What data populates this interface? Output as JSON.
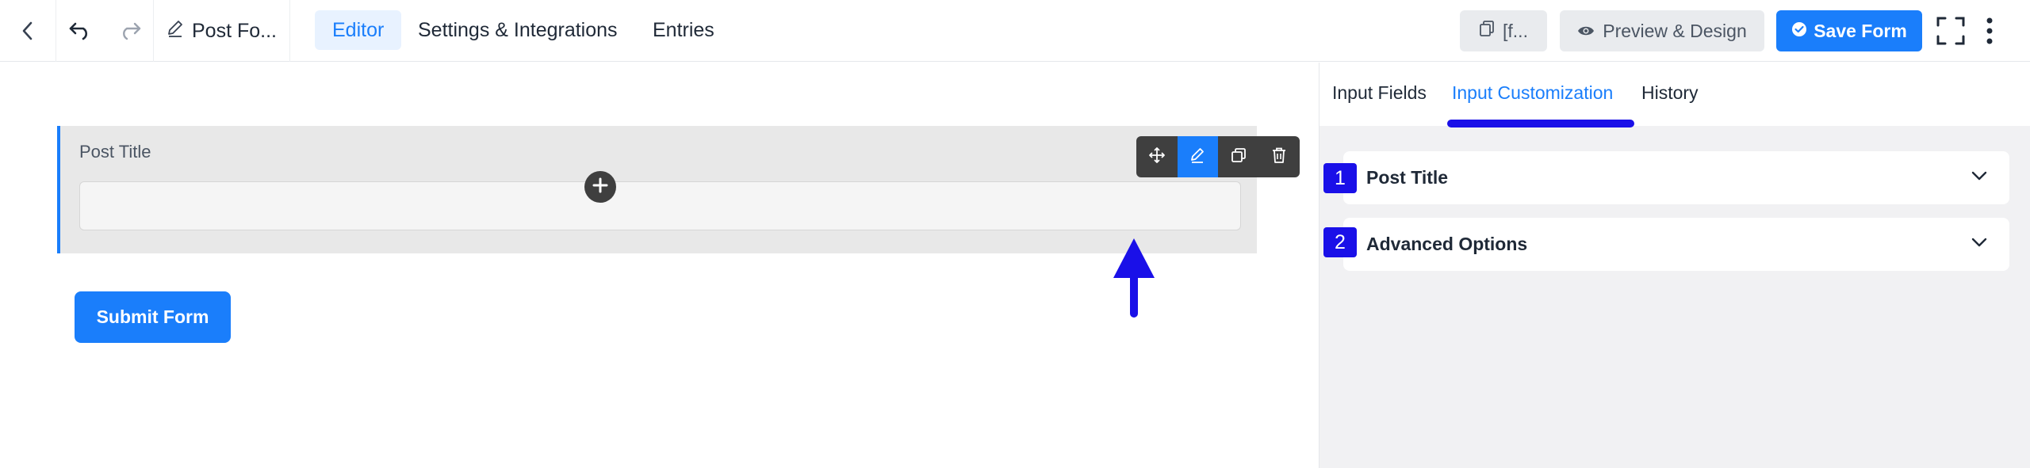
{
  "topbar": {
    "back_icon": "chevron-left-icon",
    "undo_icon": "undo-icon",
    "redo_icon": "redo-icon",
    "form_title": "Post Fo...",
    "tabs": [
      {
        "label": "Editor",
        "active": true
      },
      {
        "label": "Settings & Integrations",
        "active": false
      },
      {
        "label": "Entries",
        "active": false
      }
    ],
    "shortcode_label": "[f...",
    "preview_label": "Preview & Design",
    "save_label": "Save Form",
    "fullscreen_icon": "fullscreen-icon",
    "more_icon": "more-vertical-icon"
  },
  "canvas": {
    "field": {
      "label": "Post Title",
      "value": "",
      "toolbar_icons": [
        "move-icon",
        "edit-icon",
        "duplicate-icon",
        "trash-icon"
      ]
    },
    "submit_label": "Submit Form"
  },
  "panel": {
    "tabs": [
      {
        "label": "Input Fields",
        "active": false
      },
      {
        "label": "Input Customization",
        "active": true
      },
      {
        "label": "History",
        "active": false
      }
    ],
    "sections": [
      {
        "badge": "1",
        "title": "Post Title"
      },
      {
        "badge": "2",
        "title": "Advanced Options"
      }
    ]
  },
  "colors": {
    "accent": "#1a7efb",
    "annotation": "#1a10e8"
  }
}
